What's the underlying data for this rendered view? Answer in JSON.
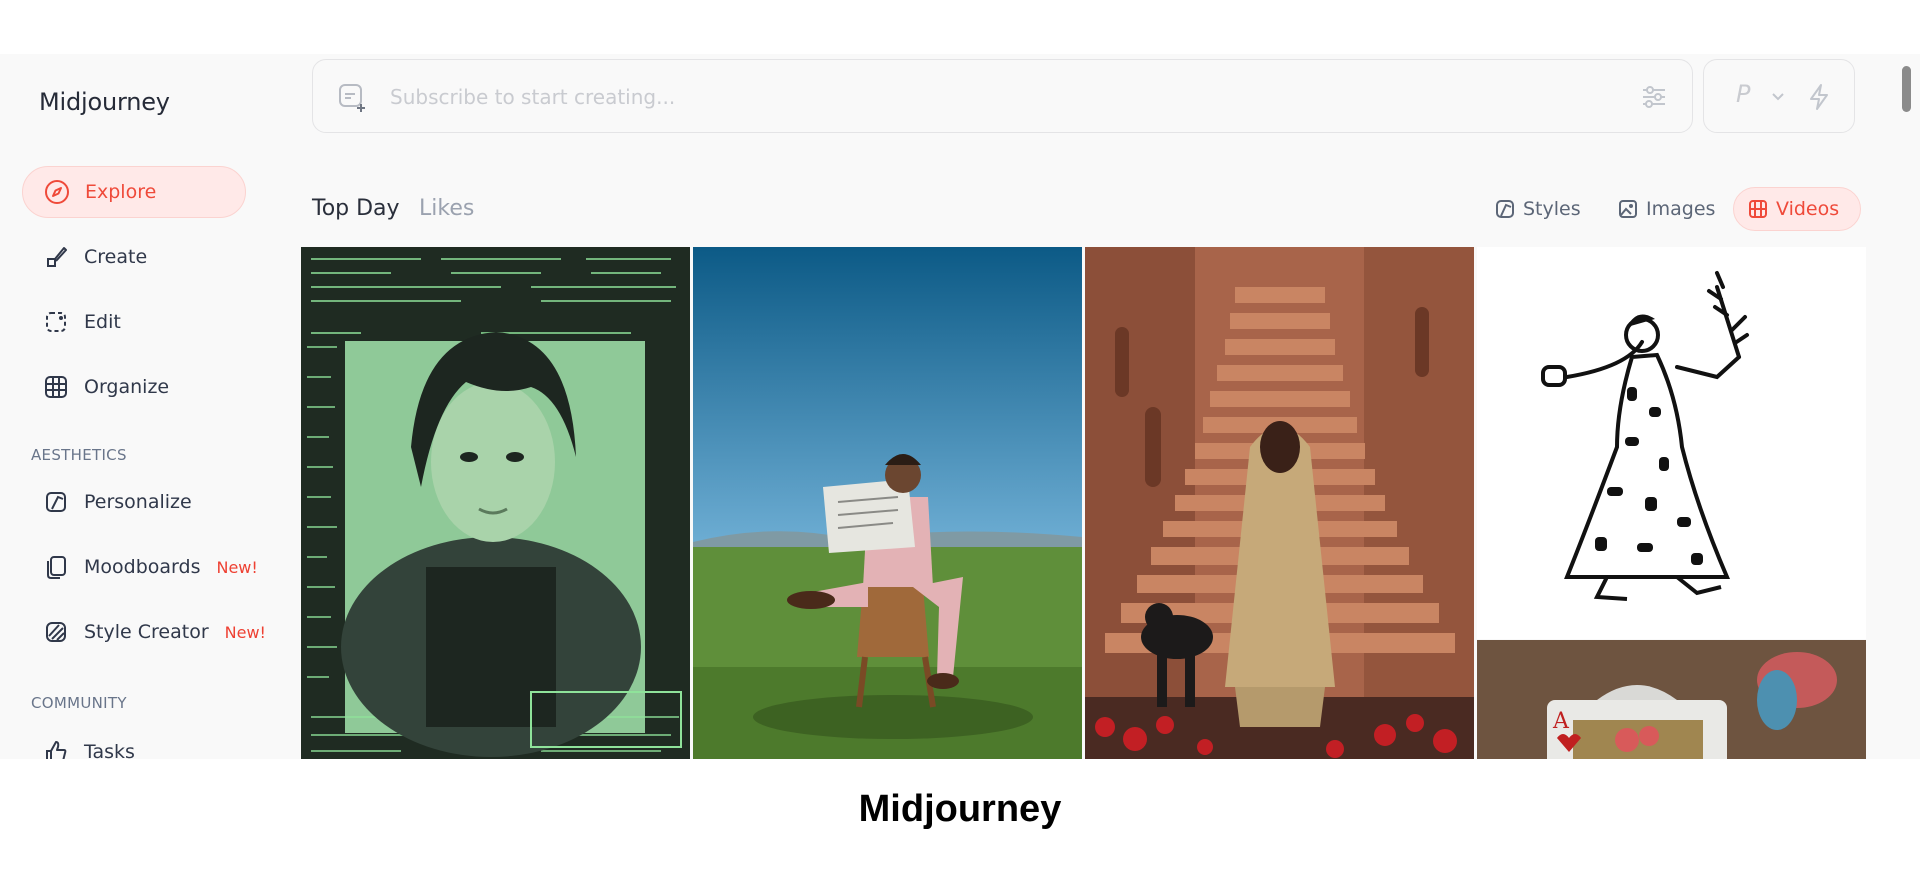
{
  "app": {
    "brand": "Midjourney"
  },
  "sidebar": {
    "items": [
      {
        "label": "Explore",
        "icon": "compass-icon",
        "active": true
      },
      {
        "label": "Create",
        "icon": "brush-icon"
      },
      {
        "label": "Edit",
        "icon": "edit-frame-icon"
      },
      {
        "label": "Organize",
        "icon": "grid-icon"
      }
    ],
    "aesthetics_heading": "AESTHETICS",
    "aesthetics": [
      {
        "label": "Personalize",
        "icon": "personalize-icon"
      },
      {
        "label": "Moodboards",
        "icon": "moodboards-icon",
        "badge": "New!"
      },
      {
        "label": "Style Creator",
        "icon": "style-creator-icon",
        "badge": "New!"
      }
    ],
    "community_heading": "COMMUNITY",
    "community": [
      {
        "label": "Tasks",
        "icon": "thumbs-up-icon"
      }
    ]
  },
  "prompt": {
    "placeholder": "Subscribe to start creating...",
    "mode_letter": "P"
  },
  "tabs": [
    {
      "label": "Top Day",
      "active": true
    },
    {
      "label": "Likes",
      "active": false
    }
  ],
  "filters": [
    {
      "label": "Styles",
      "icon": "styles-icon"
    },
    {
      "label": "Images",
      "icon": "image-icon"
    },
    {
      "label": "Videos",
      "icon": "film-icon",
      "active": true
    }
  ],
  "gallery": [
    {
      "name": "tile-green-terminal-portrait"
    },
    {
      "name": "tile-man-reading-newspaper-field"
    },
    {
      "name": "tile-woman-stairs-panther"
    },
    {
      "name": "tile-ink-sketch-woman"
    },
    {
      "name": "tile-ace-of-hearts-card"
    }
  ],
  "caption": "Midjourney",
  "colors": {
    "accent": "#ef4a3a",
    "accent_bg": "#ffe9e8",
    "panel": "#f9f9f9"
  }
}
